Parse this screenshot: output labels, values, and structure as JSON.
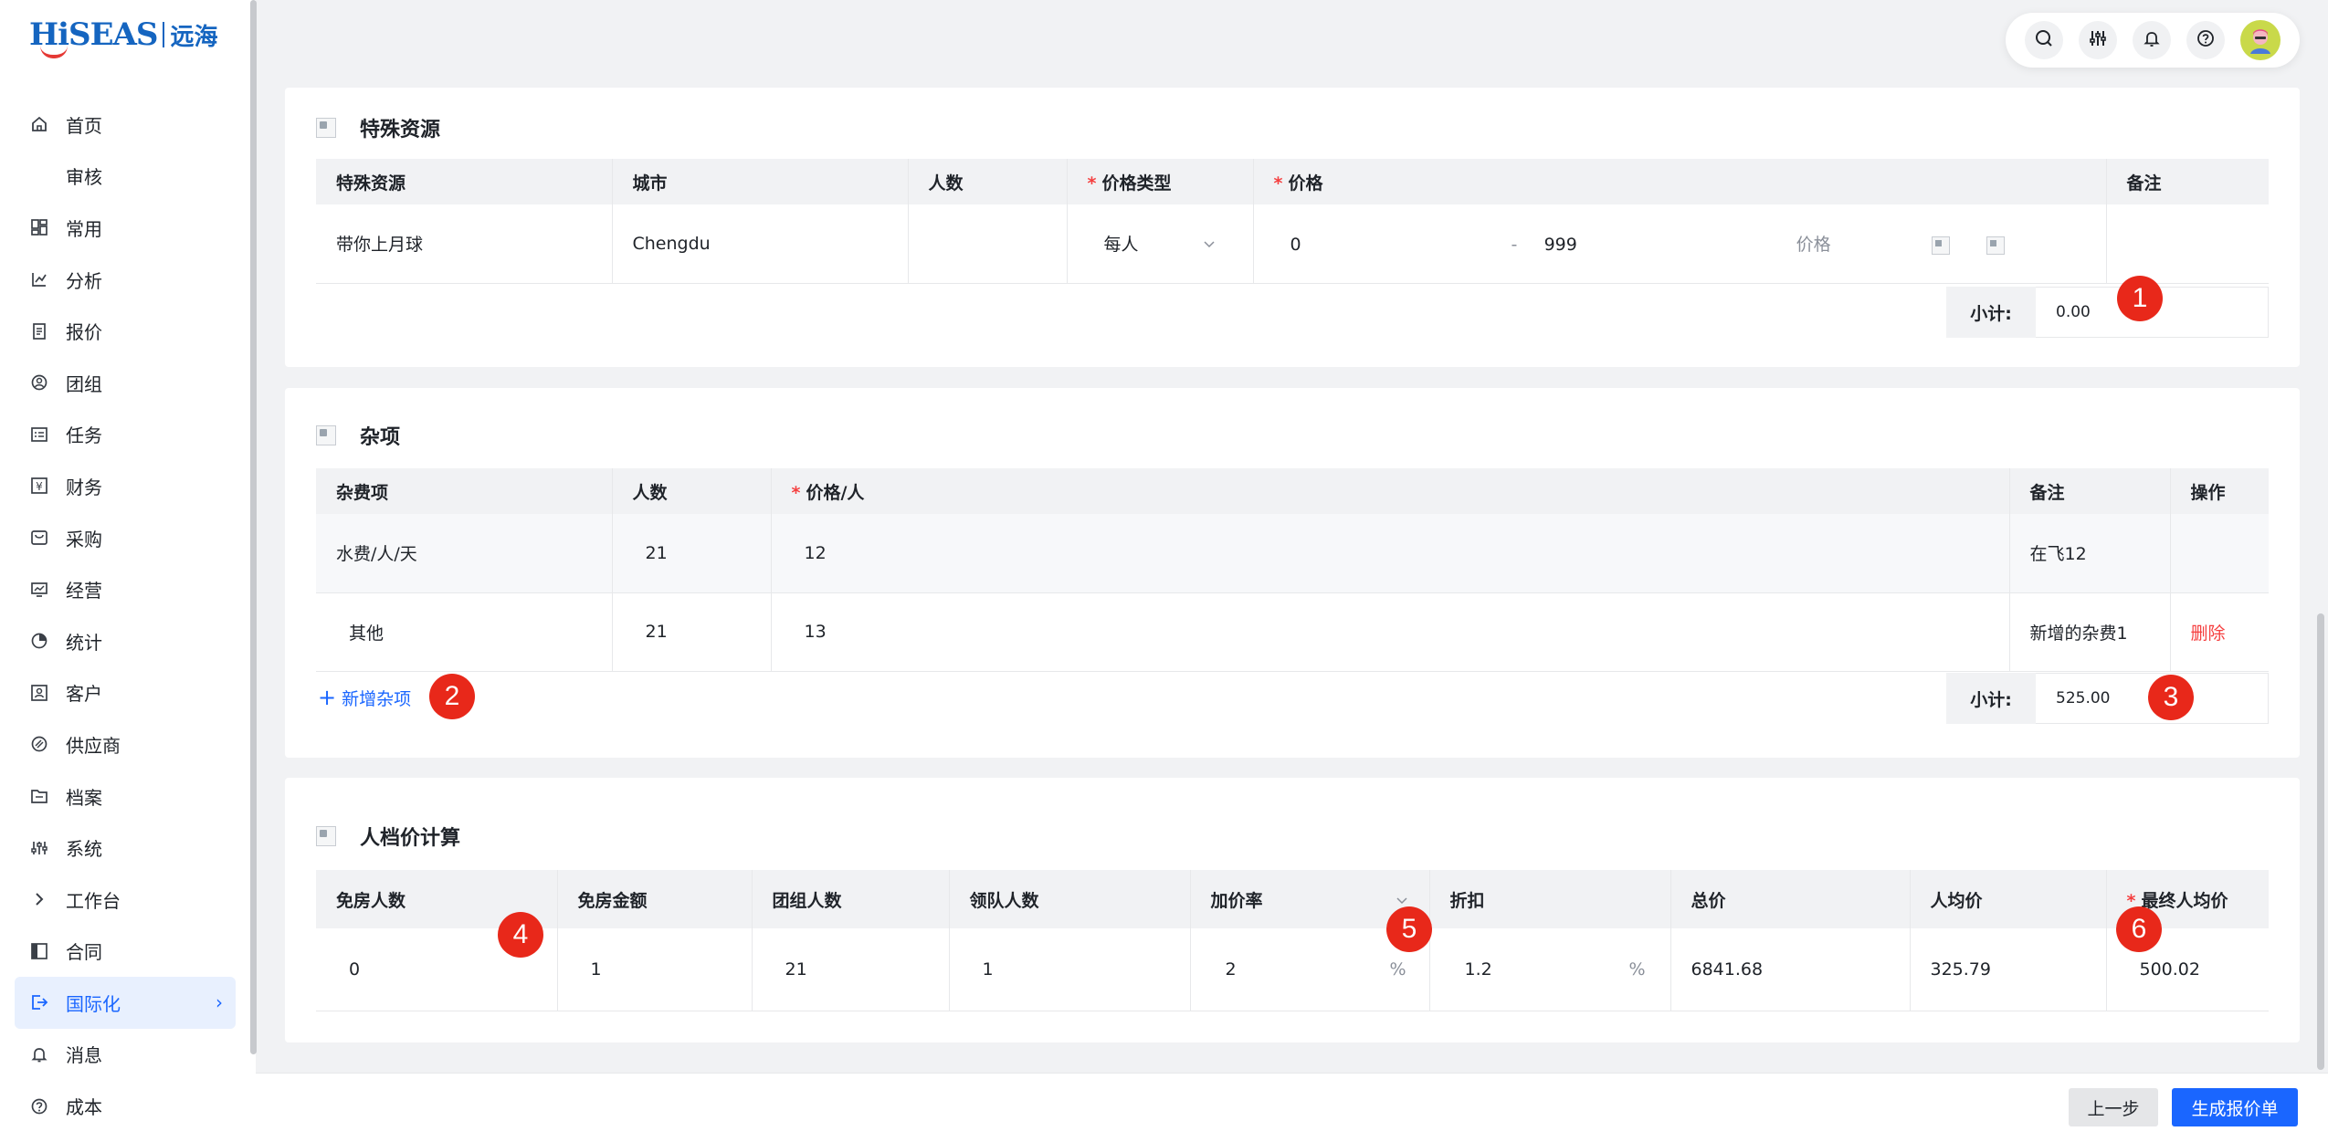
{
  "app": {
    "logo_text": "HiSEAS",
    "logo_cn": "远海"
  },
  "sidebar": {
    "items": [
      {
        "label": "首页",
        "icon": "home-icon"
      },
      {
        "label": "审核",
        "icon": ""
      },
      {
        "label": "常用",
        "icon": "dashboard-icon"
      },
      {
        "label": "分析",
        "icon": "analysis-icon"
      },
      {
        "label": "报价",
        "icon": "document-icon"
      },
      {
        "label": "团组",
        "icon": "group-icon"
      },
      {
        "label": "任务",
        "icon": "task-icon"
      },
      {
        "label": "财务",
        "icon": "finance-icon"
      },
      {
        "label": "采购",
        "icon": "purchase-icon"
      },
      {
        "label": "经营",
        "icon": "operation-icon"
      },
      {
        "label": "统计",
        "icon": "pie-icon"
      },
      {
        "label": "客户",
        "icon": "customer-icon"
      },
      {
        "label": "供应商",
        "icon": "supplier-icon"
      },
      {
        "label": "档案",
        "icon": "folder-icon"
      },
      {
        "label": "系统",
        "icon": "sliders-icon"
      },
      {
        "label": "工作台",
        "icon": "chevron-right-icon"
      },
      {
        "label": "合同",
        "icon": "contract-icon"
      },
      {
        "label": "国际化",
        "icon": "export-icon",
        "active": true
      },
      {
        "label": "消息",
        "icon": "bell-icon"
      },
      {
        "label": "成本",
        "icon": "help-icon"
      }
    ]
  },
  "topbar": {
    "icons": [
      "search-icon",
      "settings-icon",
      "bell-icon",
      "help-icon",
      "avatar"
    ]
  },
  "special": {
    "title": "特殊资源",
    "headers": [
      "特殊资源",
      "城市",
      "人数",
      "价格类型",
      "价格",
      "备注"
    ],
    "row": {
      "resource": "带你上月球",
      "city": "Chengdu",
      "people": "",
      "price_type": "每人",
      "price_min": "0",
      "dash": "-",
      "price_max": "999",
      "price_placeholder": "价格",
      "remark": ""
    },
    "subtotal_label": "小计:",
    "subtotal_value": "0.00"
  },
  "misc": {
    "title": "杂项",
    "headers": [
      "杂费项",
      "人数",
      "价格/人",
      "备注",
      "操作"
    ],
    "rows": [
      {
        "item": "水费/人/天",
        "people": "21",
        "price": "12",
        "remark": "在飞12",
        "action": ""
      },
      {
        "item": "其他",
        "people": "21",
        "price": "13",
        "remark": "新增的杂费1",
        "action": "删除"
      }
    ],
    "add_label": "新增杂项",
    "subtotal_label": "小计:",
    "subtotal_value": "525.00"
  },
  "calc": {
    "title": "人档价计算",
    "headers": [
      "免房人数",
      "免房金额",
      "团组人数",
      "领队人数",
      "加价率",
      "折扣",
      "总价",
      "人均价",
      "最终人均价"
    ],
    "row": {
      "free_rooms": "0",
      "free_amount": "1",
      "group_size": "21",
      "leaders": "1",
      "markup": "2",
      "markup_unit": "%",
      "discount": "1.2",
      "discount_unit": "%",
      "total": "6841.68",
      "avg": "325.79",
      "final_avg": "500.02"
    }
  },
  "badges": [
    "1",
    "2",
    "3",
    "4",
    "5",
    "6"
  ],
  "footer": {
    "prev": "上一步",
    "generate": "生成报价单"
  },
  "colors": {
    "primary": "#1a66ff",
    "badge": "#e8281a",
    "danger": "#f53f3f"
  }
}
